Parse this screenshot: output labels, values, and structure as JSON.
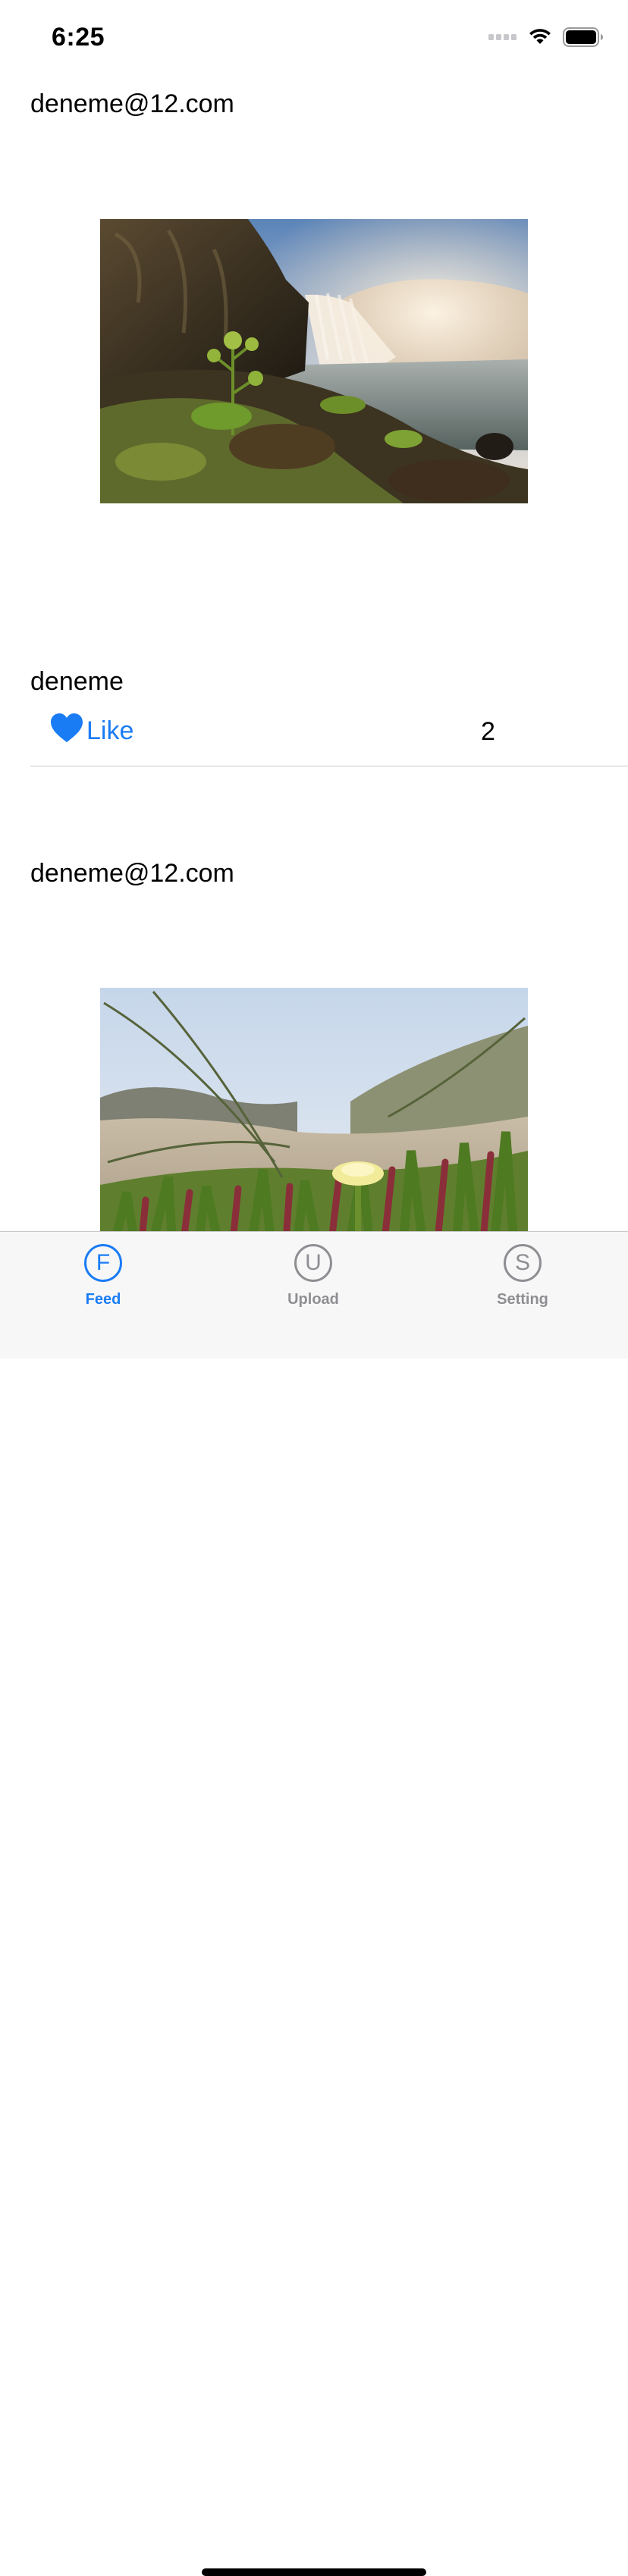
{
  "status_bar": {
    "time": "6:25",
    "icons": [
      "signal-icon",
      "wifi-icon",
      "battery-icon"
    ]
  },
  "colors": {
    "accent": "#1a7cf5",
    "inactive": "#8e8e93",
    "tab_bar_background": "#f7f7f7",
    "separator": "#c8c8cc"
  },
  "feed": {
    "posts": [
      {
        "email": "deneme@12.com",
        "image": "waterfall-photo",
        "caption": "deneme",
        "like_label": "Like",
        "like_count": "2",
        "like_icon": "heart-icon"
      },
      {
        "email": "deneme@12.com",
        "image": "flower-photo"
      }
    ]
  },
  "tab_bar": {
    "tabs": [
      {
        "label": "Feed",
        "icon_letter": "F",
        "active": true
      },
      {
        "label": "Upload",
        "icon_letter": "U",
        "active": false
      },
      {
        "label": "Setting",
        "icon_letter": "S",
        "active": false
      }
    ]
  }
}
